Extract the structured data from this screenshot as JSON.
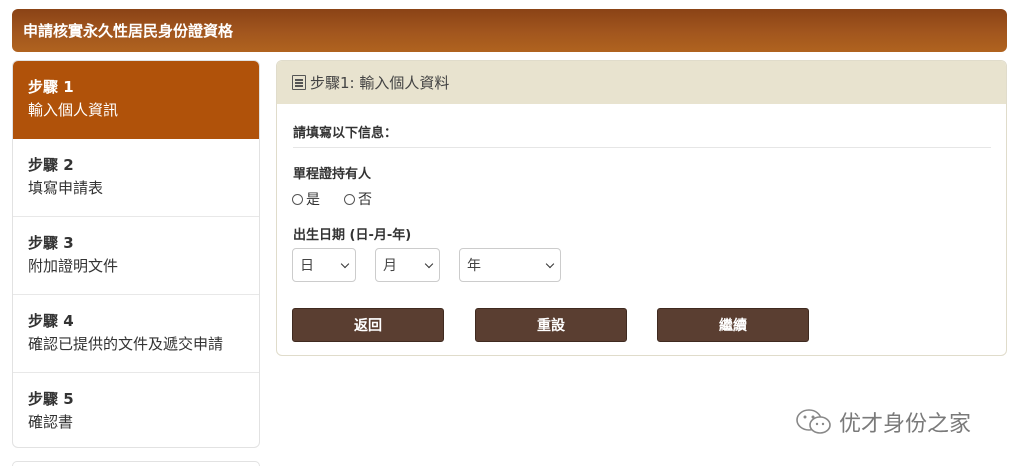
{
  "header": {
    "title": "申請核實永久性居民身份證資格"
  },
  "sidebar": {
    "steps": [
      {
        "num": "步驟 1",
        "label": "輸入個人資訊",
        "active": true
      },
      {
        "num": "步驟 2",
        "label": "填寫申請表",
        "active": false
      },
      {
        "num": "步驟 3",
        "label": "附加證明文件",
        "active": false
      },
      {
        "num": "步驟 4",
        "label": "確認已提供的文件及遞交申請",
        "active": false
      },
      {
        "num": "步驟 5",
        "label": "確認書",
        "active": false
      }
    ]
  },
  "panel": {
    "title": "步驟1: 輸入個人資料",
    "prompt": "請填寫以下信息：",
    "holder_label": "單程證持有人",
    "radio_yes": "是",
    "radio_no": "否",
    "dob_label": "出生日期 (日-月-年)",
    "day_select": "日",
    "month_select": "月",
    "year_select": "年"
  },
  "buttons": {
    "back": "返回",
    "reset": "重設",
    "continue": "繼續"
  },
  "watermark": {
    "text": "优才身份之家"
  },
  "colors": {
    "header": "#a2561e",
    "active_step": "#b0520a",
    "panel_head": "#e8e3cf",
    "button": "#5a3e31"
  }
}
